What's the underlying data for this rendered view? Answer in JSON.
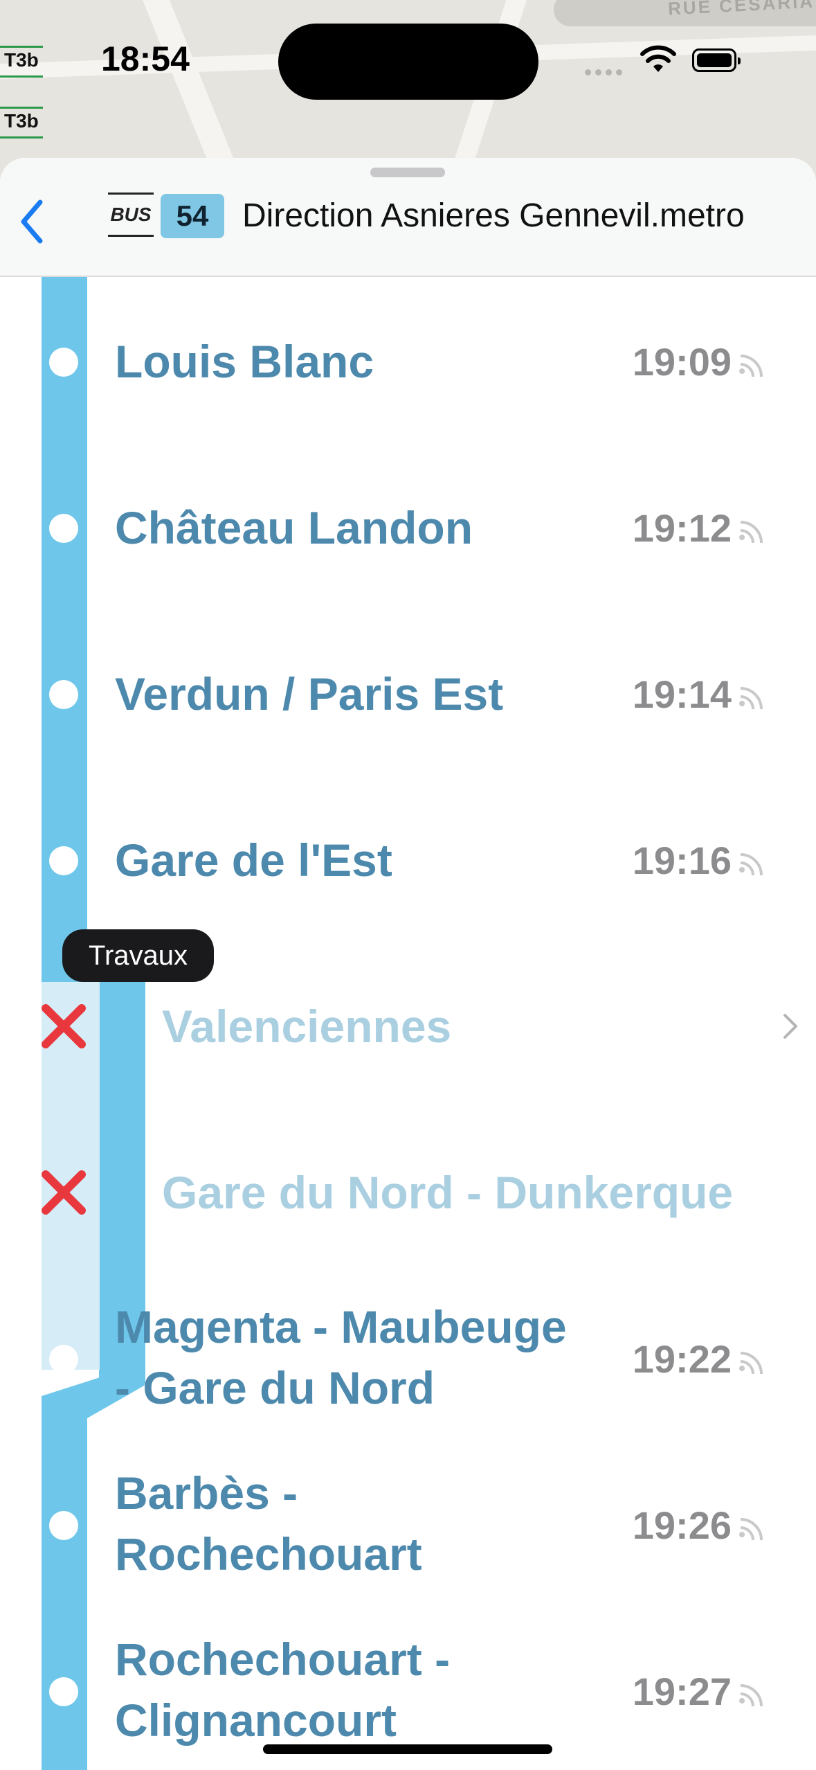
{
  "map": {
    "street_name": "RUE CESARIA",
    "tram_badges": [
      "T3b",
      "T3b"
    ]
  },
  "status_bar": {
    "time": "18:54"
  },
  "header": {
    "mode_label": "BUS",
    "line_number": "54",
    "direction": "Direction Asnieres Gennevil.metro"
  },
  "colors": {
    "line": "#6ec7ea",
    "stop_text": "#4c89ad",
    "disabled_text": "#a9cfe1",
    "cross": "#e8383d"
  },
  "alert": {
    "label": "Travaux"
  },
  "stops": [
    {
      "name": "Louis Blanc",
      "time": "19:09",
      "realtime": true
    },
    {
      "name": "Château Landon",
      "time": "19:12",
      "realtime": true
    },
    {
      "name": "Verdun / Paris Est",
      "time": "19:14",
      "realtime": true
    },
    {
      "name": "Gare de l'Est",
      "time": "19:16",
      "realtime": true
    },
    {
      "name": "Valenciennes",
      "time": "",
      "disabled": true
    },
    {
      "name": "Gare du Nord - Dunkerque",
      "time": "",
      "disabled": true
    },
    {
      "name_line1": "Magenta - Maubeuge",
      "name_line2": "- Gare du Nord",
      "time": "19:22",
      "realtime": true
    },
    {
      "name_line1": "Barbès -",
      "name_line2": "Rochechouart",
      "time": "19:26",
      "realtime": true
    },
    {
      "name_line1": "Rochechouart -",
      "name_line2": "Clignancourt",
      "time": "19:27",
      "realtime": true
    }
  ]
}
